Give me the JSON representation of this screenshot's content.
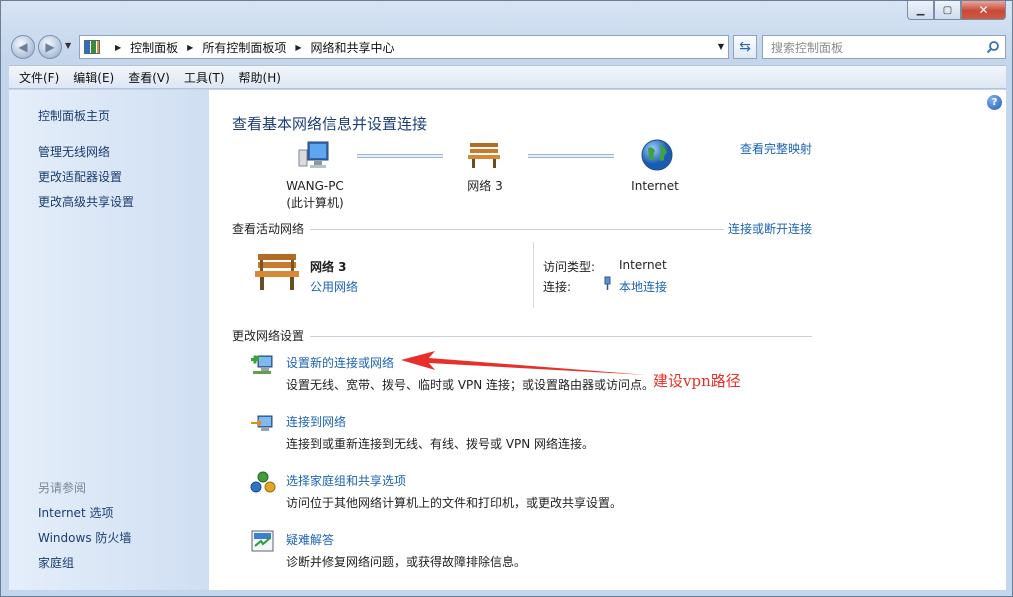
{
  "address_bar": {
    "crumbs": [
      "控制面板",
      "所有控制面板项",
      "网络和共享中心"
    ]
  },
  "search": {
    "placeholder": "搜索控制面板"
  },
  "menu": {
    "items": [
      "文件(F)",
      "编辑(E)",
      "查看(V)",
      "工具(T)",
      "帮助(H)"
    ]
  },
  "sidebar": {
    "home": "控制面板主页",
    "links": [
      "管理无线网络",
      "更改适配器设置",
      "更改高级共享设置"
    ],
    "see_also_heading": "另请参阅",
    "see_also": [
      "Internet 选项",
      "Windows 防火墙",
      "家庭组"
    ]
  },
  "main": {
    "title": "查看基本网络信息并设置连接",
    "full_map_link": "查看完整映射",
    "map": {
      "computer_name": "WANG-PC",
      "computer_sub": "(此计算机)",
      "network": "网络  3",
      "internet": "Internet"
    },
    "active_networks": {
      "heading": "查看活动网络",
      "connect_link": "连接或断开连接",
      "network_name": "网络  3",
      "network_type": "公用网络",
      "access_type_label": "访问类型:",
      "access_type_value": "Internet",
      "connections_label": "连接:",
      "connections_value": "本地连接"
    },
    "change_settings": {
      "heading": "更改网络设置",
      "tasks": [
        {
          "link": "设置新的连接或网络",
          "desc": "设置无线、宽带、拨号、临时或 VPN 连接；或设置路由器或访问点。"
        },
        {
          "link": "连接到网络",
          "desc": "连接到或重新连接到无线、有线、拨号或 VPN 网络连接。"
        },
        {
          "link": "选择家庭组和共享选项",
          "desc": "访问位于其他网络计算机上的文件和打印机，或更改共享设置。"
        },
        {
          "link": "疑难解答",
          "desc": "诊断并修复网络问题，或获得故障排除信息。"
        }
      ]
    },
    "annotation": "建设vpn路径"
  },
  "colors": {
    "link": "#1c63b7",
    "title": "#1e3d7a",
    "annotation": "#e8302a"
  }
}
